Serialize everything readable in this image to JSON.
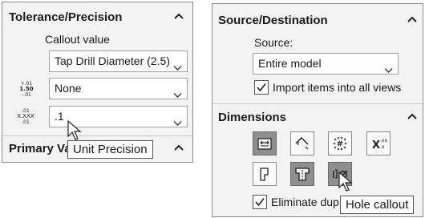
{
  "left_panel": {
    "title": "Tolerance/Precision",
    "callout_label": "Callout value",
    "callout_value": "Tap Drill Diameter (2.5)",
    "tolerance_icon": [
      "+.01",
      "1.50",
      "-.01"
    ],
    "tolerance_value": "None",
    "precision_icon": [
      ".01",
      "X.XXX",
      ".01"
    ],
    "precision_value": ".1",
    "primary_title_partial": "Primary Va",
    "tooltip": "Unit Precision"
  },
  "right_panel": {
    "title": "Source/Destination",
    "source_label": "Source:",
    "source_value": "Entire model",
    "import_label": "Import items into all views",
    "import_checked": true,
    "dimensions_title": "Dimensions",
    "eliminate_partial": "Eliminate dup",
    "eliminate_checked": true,
    "tooltip": "Hole callout",
    "buttons": [
      {
        "icon": "dimension-marked-for-drawing-icon",
        "pressed": true
      },
      {
        "icon": "not-marked-for-drawing-icon",
        "pressed": false
      },
      {
        "icon": "instance-count-icon",
        "pressed": false
      },
      {
        "icon": "tolerance-dimensions-icon",
        "pressed": false
      },
      {
        "icon": "hole-wizard-locations-icon",
        "pressed": false
      },
      {
        "icon": "hole-wizard-profile-icon",
        "pressed": true
      },
      {
        "icon": "hole-callout-icon",
        "pressed": true
      }
    ]
  }
}
